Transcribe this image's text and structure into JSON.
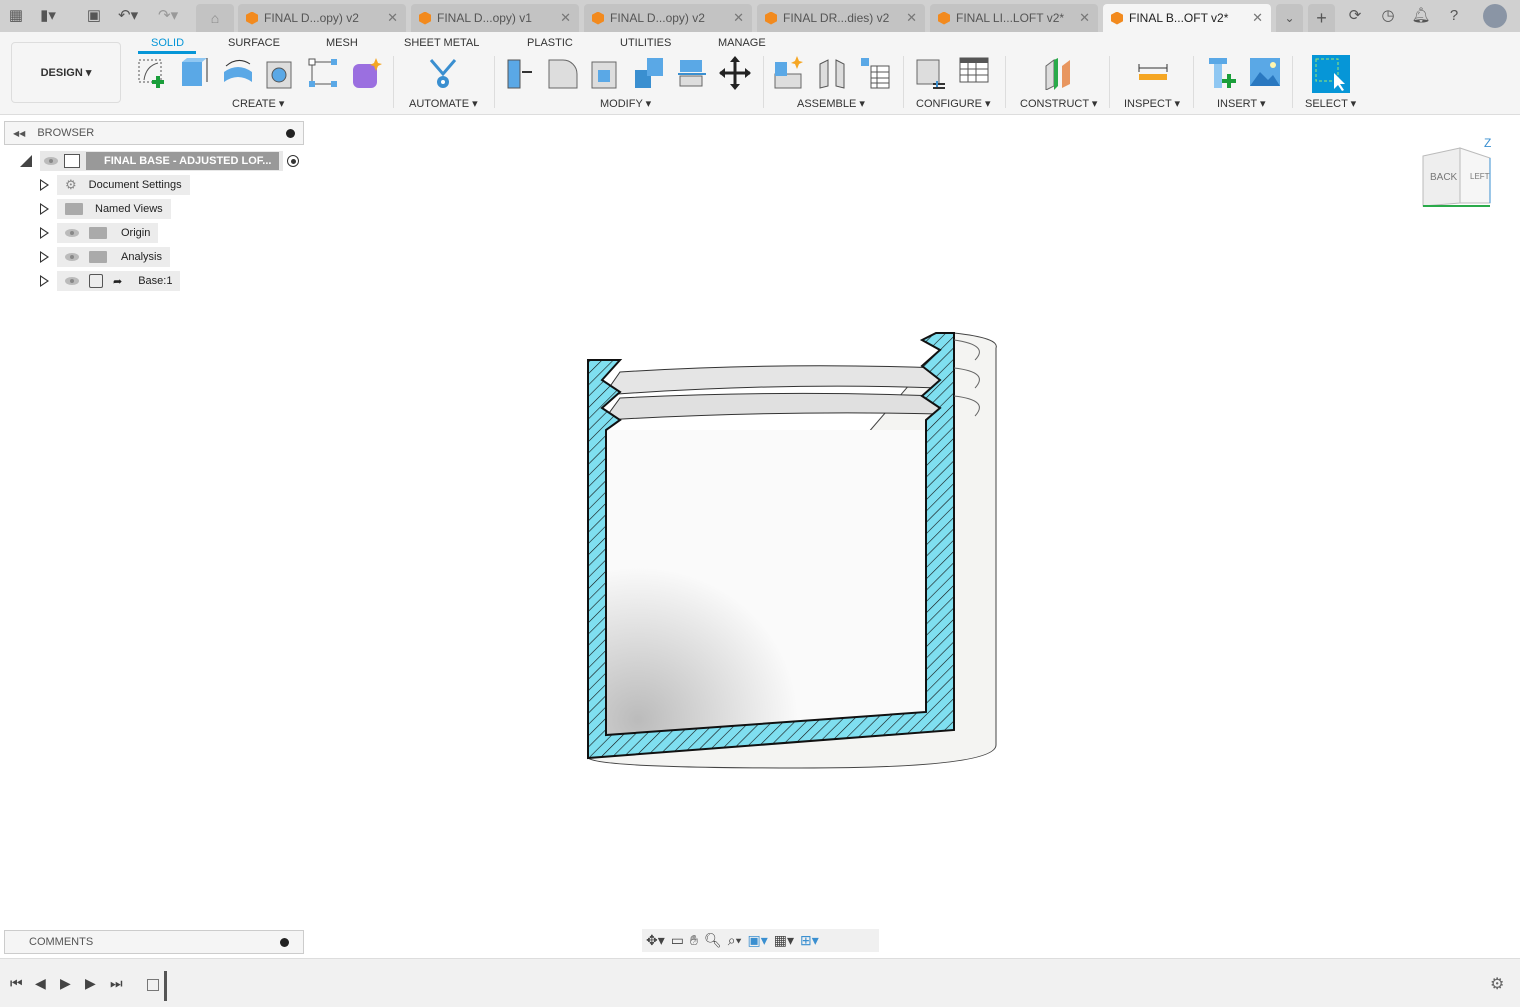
{
  "quick_access": {
    "icons": [
      "grid-menu-icon",
      "file-icon",
      "save-icon",
      "undo-icon",
      "redo-icon",
      "home-icon"
    ]
  },
  "doc_tabs": [
    {
      "label": "FINAL D...opy) v2",
      "active": false
    },
    {
      "label": "FINAL D...opy) v1",
      "active": false
    },
    {
      "label": "FINAL D...opy) v2",
      "active": false
    },
    {
      "label": "FINAL DR...dies) v2",
      "active": false
    },
    {
      "label": "FINAL LI...LOFT v2*",
      "active": false
    },
    {
      "label": "FINAL B...OFT v2*",
      "active": true
    }
  ],
  "close_glyph": "✕",
  "toolbar": {
    "workspace": "DESIGN ▾",
    "tabs": [
      {
        "label": "SOLID",
        "active": true
      },
      {
        "label": "SURFACE"
      },
      {
        "label": "MESH"
      },
      {
        "label": "SHEET METAL"
      },
      {
        "label": "PLASTIC"
      },
      {
        "label": "UTILITIES"
      },
      {
        "label": "MANAGE"
      }
    ],
    "groups": [
      "CREATE ▾",
      "AUTOMATE ▾",
      "MODIFY ▾",
      "ASSEMBLE ▾",
      "CONFIGURE ▾",
      "CONSTRUCT ▾",
      "INSPECT ▾",
      "INSERT ▾",
      "SELECT ▾"
    ]
  },
  "accent_color": "#0696d7",
  "browser": {
    "title": "BROWSER",
    "root": "FINAL BASE - ADJUSTED LOF...",
    "items": [
      {
        "label": "Document Settings"
      },
      {
        "label": "Named Views"
      },
      {
        "label": "Origin"
      },
      {
        "label": "Analysis"
      },
      {
        "label": "Base:1"
      }
    ]
  },
  "viewcube": {
    "back": "BACK",
    "left": "LEFT",
    "z": "Z"
  },
  "comments": {
    "title": "COMMENTS"
  },
  "section_color": "#7fdff0"
}
